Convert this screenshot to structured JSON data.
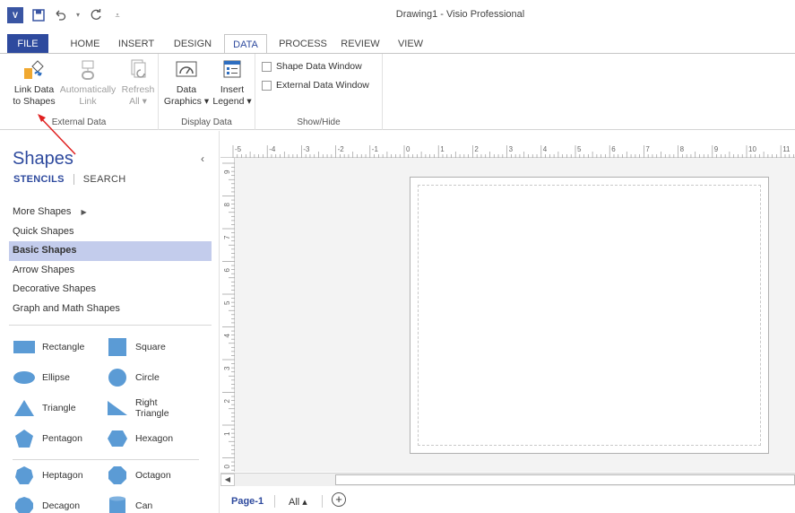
{
  "title": "Drawing1 - Visio Professional",
  "qat": {
    "logo": "V",
    "save_icon": "save-icon",
    "undo_icon": "undo-icon",
    "redo_icon": "redo-icon",
    "customize_icon": "customize-icon"
  },
  "tabs": [
    "FILE",
    "HOME",
    "INSERT",
    "DESIGN",
    "DATA",
    "PROCESS",
    "REVIEW",
    "VIEW"
  ],
  "active_tab": "DATA",
  "ribbon": {
    "external_data": {
      "label": "External Data",
      "link_data": [
        "Link Data",
        "to Shapes"
      ],
      "auto_link": [
        "Automatically",
        "Link"
      ],
      "refresh": [
        "Refresh",
        "All ▾"
      ]
    },
    "display_data": {
      "label": "Display Data",
      "data_graphics": [
        "Data",
        "Graphics ▾"
      ],
      "insert_legend": [
        "Insert",
        "Legend ▾"
      ]
    },
    "show_hide": {
      "label": "Show/Hide",
      "shape_data_window": "Shape Data Window",
      "external_data_window": "External Data Window"
    }
  },
  "shapes_pane": {
    "title": "Shapes",
    "collapse": "‹",
    "tab_stencils": "STENCILS",
    "tab_search": "SEARCH",
    "stencils": [
      "More Shapes",
      "Quick Shapes",
      "Basic Shapes",
      "Arrow Shapes",
      "Decorative Shapes",
      "Graph and Math Shapes"
    ],
    "more_arrow": "▶",
    "selected": "Basic Shapes",
    "shapes": [
      [
        "Rectangle",
        "Square"
      ],
      [
        "Ellipse",
        "Circle"
      ],
      [
        "Triangle",
        "Right Triangle"
      ],
      [
        "Pentagon",
        "Hexagon"
      ],
      [
        "Heptagon",
        "Octagon"
      ],
      [
        "Decagon",
        "Can"
      ]
    ],
    "shape_color": "#5b9bd5"
  },
  "ruler": {
    "top_labels": [
      "-5",
      "-4",
      "-3",
      "-2",
      "-1",
      "0",
      "1",
      "2",
      "3",
      "4",
      "5",
      "6",
      "7",
      "8",
      "9",
      "10",
      "11"
    ],
    "left_labels": [
      "9",
      "8",
      "7",
      "6",
      "5",
      "4",
      "3",
      "2",
      "1",
      "0"
    ]
  },
  "page_tabs": {
    "page1": "Page-1",
    "all": "All ▴",
    "add": "+"
  },
  "colors": {
    "accent": "#2e4a9e",
    "selected_bg": "#c3ccec",
    "annotation": "#e02020"
  }
}
